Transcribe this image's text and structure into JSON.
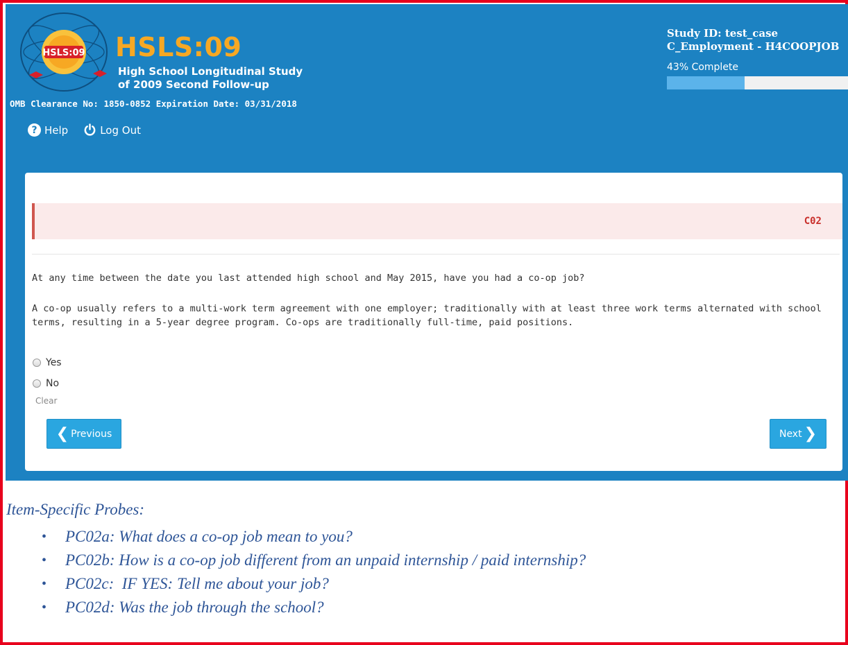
{
  "header": {
    "seal_text": "HSLS:09",
    "brand_title": "HSLS:09",
    "brand_subtitle_line1": "High School Longitudinal Study",
    "brand_subtitle_line2": "of 2009 Second Follow-up",
    "omb": "OMB Clearance No: 1850-0852 Expiration Date: 03/31/2018",
    "help_label": "Help",
    "logout_label": "Log Out"
  },
  "status": {
    "study_id": "Study ID: test_case",
    "section": "C_Employment - H4COOPJOB",
    "progress_label": "43% Complete",
    "progress_fraction": 0.43
  },
  "item": {
    "code": "C02",
    "question": "At any time between the date you last attended high school and May 2015, have you had a co-op job?",
    "explanation": "A co-op usually refers to a multi-work term agreement with one employer; traditionally with at least three work terms alternated with school terms, resulting in a 5-year degree program. Co-ops are traditionally full-time, paid positions.",
    "options": [
      "Yes",
      "No"
    ],
    "clear_label": "Clear",
    "prev_label": "Previous",
    "next_label": "Next"
  },
  "probes": {
    "title": "Item-Specific Probes:",
    "items": [
      "PC02a: What does a co-op job mean to you?",
      "PC02b: How is a co-op job different from an unpaid internship / paid internship?",
      "PC02c:  IF YES: Tell me about your job?",
      "PC02d: Was the job through the school?"
    ]
  },
  "colors": {
    "banner": "#1c82c2",
    "brand_orange": "#f7a823",
    "item_code": "#c9302c",
    "button": "#2aa6e0",
    "probe_text": "#2e5597",
    "frame": "#e8001c"
  }
}
